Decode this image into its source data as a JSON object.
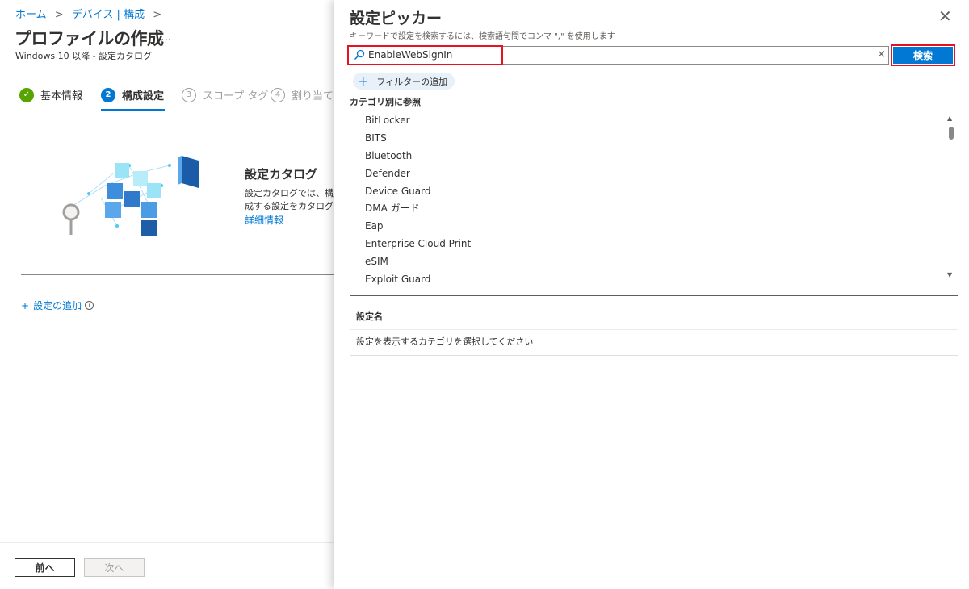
{
  "breadcrumb": {
    "items": [
      "ホーム",
      "デバイス | 構成"
    ],
    "separator": ">"
  },
  "page": {
    "title": "プロファイルの作成",
    "more_label": "...",
    "subtitle": "Windows 10 以降 - 設定カタログ"
  },
  "steps": [
    {
      "num": "✓",
      "label": "基本情報",
      "state": "done"
    },
    {
      "num": "2",
      "label": "構成設定",
      "state": "active"
    },
    {
      "num": "3",
      "label": "スコープ タグ",
      "state": "future"
    },
    {
      "num": "4",
      "label": "割り当て",
      "state": "future"
    }
  ],
  "catalog": {
    "title": "設定カタログ",
    "desc_line1": "設定カタログでは、構成",
    "desc_line2": "成する設定をカタログで",
    "link": "詳細情報"
  },
  "add_setting": {
    "plus": "+",
    "label": "設定の追加",
    "info": "i"
  },
  "footer": {
    "prev_label": "前へ",
    "next_label": "次へ"
  },
  "picker": {
    "title": "設定ピッカー",
    "hint": "キーワードで設定を検索するには、検索語句間でコンマ \",\" を使用します",
    "search_value": "EnableWebSignIn",
    "clear": "×",
    "close": "✕",
    "search_button": "検索",
    "filter_plus": "+",
    "filter_label": "フィルターの追加",
    "category_heading": "カテゴリ別に参照",
    "categories": [
      "BitLocker",
      "BITS",
      "Bluetooth",
      "Defender",
      "Device Guard",
      "DMA ガード",
      "Eap",
      "Enterprise Cloud Print",
      "eSIM",
      "Exploit Guard"
    ],
    "column_header": "設定名",
    "empty_message": "設定を表示するカテゴリを選択してください"
  },
  "colors": {
    "accent": "#0078d4",
    "success": "#57a300",
    "highlight": "#e81123"
  }
}
